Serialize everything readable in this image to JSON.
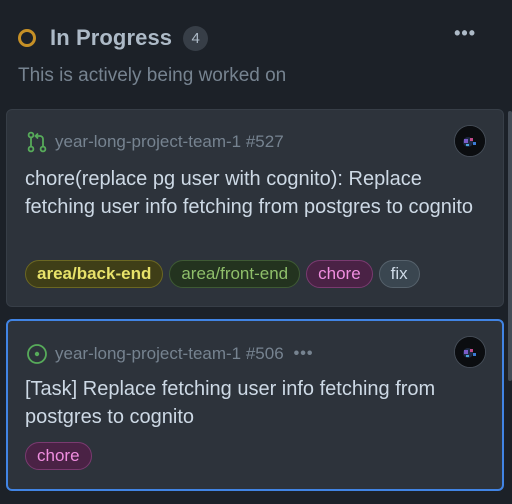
{
  "column": {
    "title": "In Progress",
    "count": "4",
    "description": "This is actively being worked on",
    "menu": "•••"
  },
  "cards": [
    {
      "type": "pull-request",
      "repo": "year-long-project-team-1 #527",
      "title": "chore(replace pg user with cognito): Replace fetching user info fetching from postgres to cognito",
      "labels": [
        "area/back-end",
        "area/front-end",
        "chore",
        "fix"
      ]
    },
    {
      "type": "issue",
      "repo": "year-long-project-team-1 #506",
      "menu": "•••",
      "title": "[Task] Replace fetching user info fetching from postgres to cognito",
      "labels": [
        "chore"
      ]
    }
  ],
  "colors": {
    "background": "#1c2128",
    "card": "#2d333b",
    "in_progress": "#c69026",
    "selected_border": "#4184e4",
    "pr_open": "#57ab5a"
  }
}
